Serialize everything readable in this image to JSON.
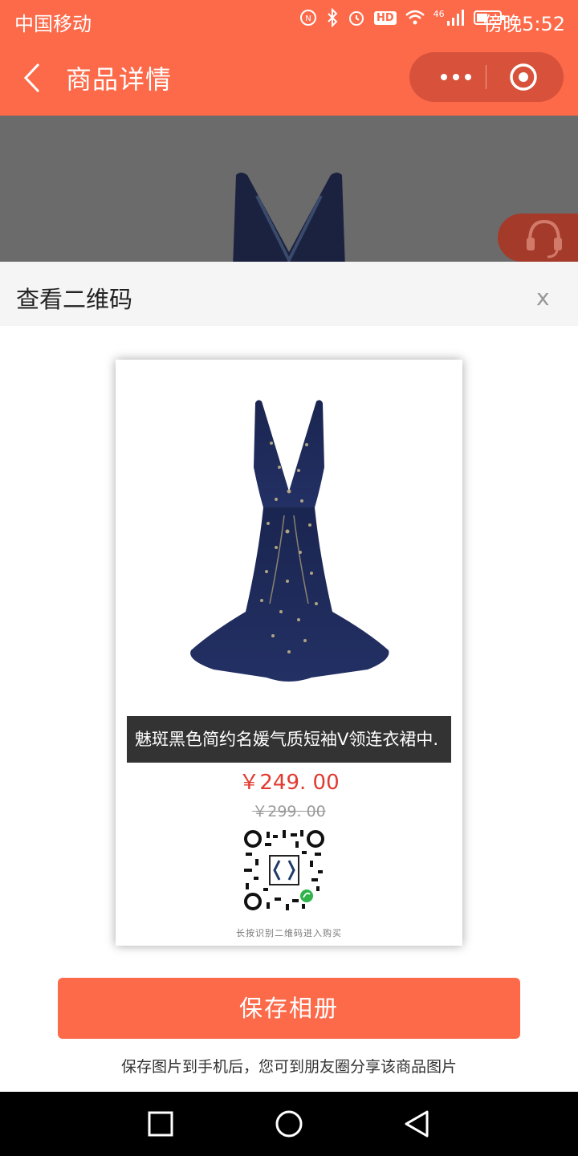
{
  "status_bar": {
    "carrier": "中国移动",
    "time": "傍晚5:52",
    "icons": [
      "nfc-icon",
      "bluetooth-icon",
      "alarm-icon",
      "hd-icon",
      "wifi-icon",
      "signal-4g-icon",
      "battery-icon"
    ],
    "network_label": "46",
    "hd_label": "HD"
  },
  "navbar": {
    "title": "商品详情",
    "back_icon": "back-chevron-icon",
    "more_icon": "more-dots-icon",
    "close_icon": "target-icon"
  },
  "sheet": {
    "title": "查看二维码",
    "close_label": "x"
  },
  "product_card": {
    "name": "魅斑黑色简约名媛气质短袖V领连衣裙中.",
    "price": "￥249. 00",
    "original_price": "￥299. 00",
    "qr_caption": "长按识别二维码进入购买"
  },
  "actions": {
    "save_button": "保存相册",
    "hint": "保存图片到手机后，您可到朋友圈分享该商品图片"
  },
  "system_nav": [
    "square-icon",
    "circle-icon",
    "back-triangle-icon"
  ],
  "colors": {
    "accent": "#fc6a4a",
    "price": "#e13a2f",
    "dress": "#1d2b55"
  }
}
